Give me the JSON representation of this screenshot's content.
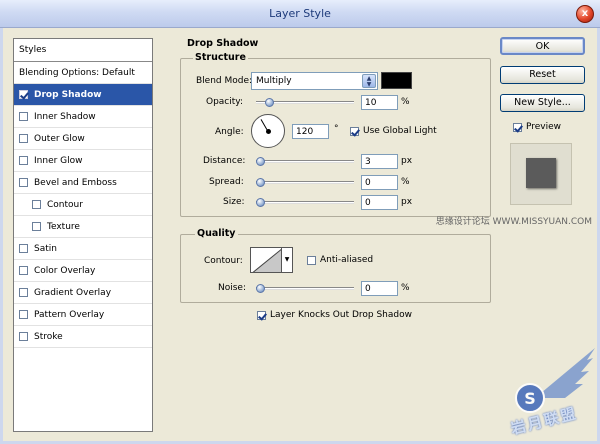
{
  "window": {
    "title": "Layer Style",
    "close_glyph": "x"
  },
  "styles": {
    "header": "Styles",
    "items": [
      {
        "label": "Blending Options: Default",
        "checkbox": false,
        "selected": false,
        "indent": false
      },
      {
        "label": "Drop Shadow",
        "checkbox": true,
        "checked": true,
        "selected": true,
        "indent": false
      },
      {
        "label": "Inner Shadow",
        "checkbox": true,
        "checked": false,
        "selected": false,
        "indent": false
      },
      {
        "label": "Outer Glow",
        "checkbox": true,
        "checked": false,
        "selected": false,
        "indent": false
      },
      {
        "label": "Inner Glow",
        "checkbox": true,
        "checked": false,
        "selected": false,
        "indent": false
      },
      {
        "label": "Bevel and Emboss",
        "checkbox": true,
        "checked": false,
        "selected": false,
        "indent": false
      },
      {
        "label": "Contour",
        "checkbox": true,
        "checked": false,
        "selected": false,
        "indent": true
      },
      {
        "label": "Texture",
        "checkbox": true,
        "checked": false,
        "selected": false,
        "indent": true
      },
      {
        "label": "Satin",
        "checkbox": true,
        "checked": false,
        "selected": false,
        "indent": false
      },
      {
        "label": "Color Overlay",
        "checkbox": true,
        "checked": false,
        "selected": false,
        "indent": false
      },
      {
        "label": "Gradient Overlay",
        "checkbox": true,
        "checked": false,
        "selected": false,
        "indent": false
      },
      {
        "label": "Pattern Overlay",
        "checkbox": true,
        "checked": false,
        "selected": false,
        "indent": false
      },
      {
        "label": "Stroke",
        "checkbox": true,
        "checked": false,
        "selected": false,
        "indent": false
      }
    ]
  },
  "drop_shadow": {
    "title": "Drop Shadow",
    "structure": {
      "title": "Structure",
      "blend_mode_label": "Blend Mode:",
      "blend_mode_value": "Multiply",
      "shadow_color": "#000000",
      "opacity_label": "Opacity:",
      "opacity_value": "10",
      "opacity_unit": "%",
      "opacity_fraction": 0.1,
      "angle_label": "Angle:",
      "angle_value": "120",
      "angle_unit": "°",
      "use_global_light_label": "Use Global Light",
      "use_global_light_checked": true,
      "distance_label": "Distance:",
      "distance_value": "3",
      "distance_unit": "px",
      "distance_fraction": 0.0,
      "spread_label": "Spread:",
      "spread_value": "0",
      "spread_unit": "%",
      "spread_fraction": 0.0,
      "size_label": "Size:",
      "size_value": "0",
      "size_unit": "px",
      "size_fraction": 0.0
    },
    "quality": {
      "title": "Quality",
      "contour_label": "Contour:",
      "anti_aliased_label": "Anti-aliased",
      "anti_aliased_checked": false,
      "noise_label": "Noise:",
      "noise_value": "0",
      "noise_unit": "%",
      "noise_fraction": 0.0
    },
    "knocks_out_label": "Layer Knocks Out Drop Shadow",
    "knocks_out_checked": true
  },
  "buttons": {
    "ok": "OK",
    "reset": "Reset",
    "new_style": "New Style...",
    "preview_label": "Preview",
    "preview_checked": true
  },
  "watermark": {
    "text": "思缘设计论坛 WWW.MISSYUAN.COM",
    "logo_text": "岩月联盟"
  }
}
